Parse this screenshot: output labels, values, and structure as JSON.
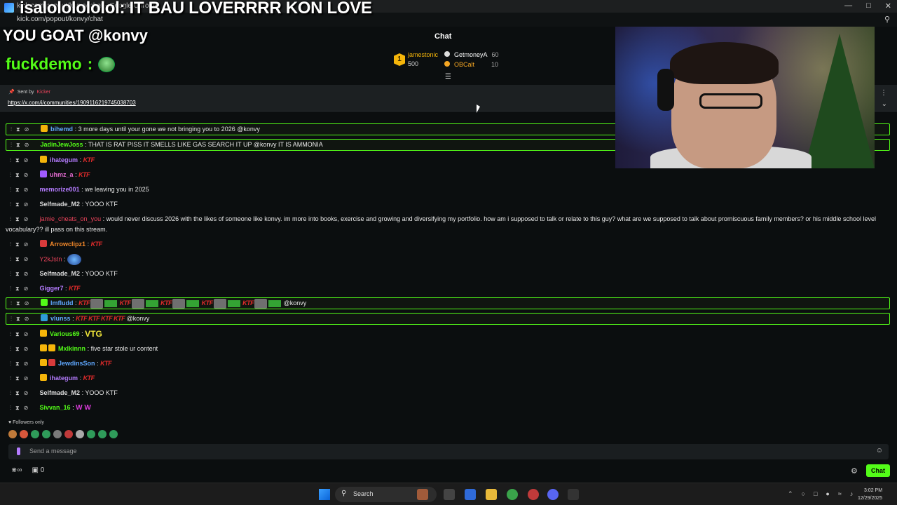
{
  "browser": {
    "title": "kick.com/popout/konvy/chat - Google Chrome",
    "url": "kick.com/popout/konvy/chat"
  },
  "overlay": {
    "line1": "isalololololol: IT BAU LOVERRRR KON LOVE",
    "line2": "YOU GOAT @konvy",
    "line3_user": "fuckdemo",
    "line3_sep": ":"
  },
  "chat": {
    "title": "Chat",
    "leaderboard": [
      {
        "name": "jamestonic",
        "value": "500",
        "rank": "1"
      },
      {
        "name": "GetmoneyA",
        "value": "60"
      },
      {
        "name": "OBCalt",
        "value": "10"
      }
    ],
    "pinned": {
      "sent_by_label": "Sent by",
      "sender": "Kicker",
      "link": "https://x.com/i/communities/1909116219745038703"
    },
    "messages": [
      {
        "user": "bihemd",
        "color": "#5fa8ff",
        "text": ": 3 more days until your gone we not bringing you to 2026 @konvy",
        "highlight": true
      },
      {
        "user": "JadinJewJoss",
        "color": "#53fc18",
        "text": ": THAT IS RAT PISS IT SMELLS LIKE GAS SEARCH IT UP @konvy IT IS AMMONIA",
        "highlight": true
      },
      {
        "user": "ihategum",
        "color": "#b57cff",
        "text": ":",
        "ktf": "KTF"
      },
      {
        "user": "uhmz_a",
        "color": "#e36bd0",
        "text": ":",
        "ktf": "KTF"
      },
      {
        "user": "memorize001",
        "color": "#b57cff",
        "text": ": we leaving you in 2025"
      },
      {
        "user": "Selfmade_M2",
        "color": "#dcdcdc",
        "text": ": YOOO KTF"
      },
      {
        "user": "jamie_cheats_on_you",
        "color": "#e9435a",
        "text": ": would never discuss 2026 with the likes of someone like konvy. im more into books, exercise and growing and diversifying my portfolio. how am i supposed to talk or relate to this guy? what are we supposed to talk about promiscuous family members? or his middle school level vocabulary?? ill pass on this stream."
      },
      {
        "user": "Arrowclipz1",
        "color": "#f58a2a",
        "text": ":",
        "ktf": "KTF"
      },
      {
        "user": "Y2kJstn",
        "color": "#e9435a",
        "text": ":"
      },
      {
        "user": "Selfmade_M2",
        "color": "#dcdcdc",
        "text": ": YOOO KTF"
      },
      {
        "user": "Gigger7",
        "color": "#b57cff",
        "text": ":",
        "ktf": "KTF"
      },
      {
        "user": "lmfludd",
        "color": "#5fa8ff",
        "text": ":",
        "tail": "@konvy",
        "highlight": true
      },
      {
        "user": "vlunss",
        "color": "#5fa8ff",
        "text": ":",
        "ktf": "KTF KTF KTF KTF",
        "tail": "@konvy",
        "highlight": true
      },
      {
        "user": "Various69",
        "color": "#53fc18",
        "text": ":",
        "vtg": "VTG"
      },
      {
        "user": "Mxlkinnn",
        "color": "#53fc18",
        "text": ": five star stole ur content"
      },
      {
        "user": "JewdinsSon",
        "color": "#5fa8ff",
        "text": ":",
        "ktf": "KTF"
      },
      {
        "user": "ihategum",
        "color": "#b57cff",
        "text": ":",
        "ktf": "KTF"
      },
      {
        "user": "Selfmade_M2",
        "color": "#dcdcdc",
        "text": ": YOOO KTF"
      },
      {
        "user": "Sivvan_16",
        "color": "#53fc18",
        "text": ":",
        "ww": "W W"
      }
    ],
    "followers_only": "Followers only",
    "input_placeholder": "Send a message",
    "bottom_count": "0",
    "send_button": "Chat"
  },
  "taskbar": {
    "search": "Search",
    "time": "3:02 PM",
    "date": "12/29/2025"
  },
  "colors": {
    "accent": "#53fc18",
    "background": "#0b0e0f",
    "gold": "#f5b50a"
  }
}
